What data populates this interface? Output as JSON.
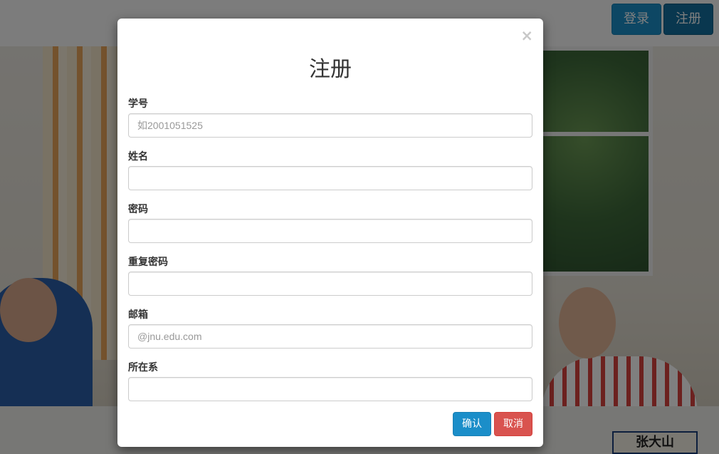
{
  "navbar": {
    "login_label": "登录",
    "register_label": "注册"
  },
  "background": {
    "nameplate_text": "张大山"
  },
  "modal": {
    "title": "注册",
    "close_symbol": "×",
    "fields": [
      {
        "label": "学号",
        "placeholder": "如2001051525",
        "value": ""
      },
      {
        "label": "姓名",
        "placeholder": "",
        "value": ""
      },
      {
        "label": "密码",
        "placeholder": "",
        "value": ""
      },
      {
        "label": "重复密码",
        "placeholder": "",
        "value": ""
      },
      {
        "label": "邮箱",
        "placeholder": "@jnu.edu.com",
        "value": ""
      },
      {
        "label": "所在系",
        "placeholder": "",
        "value": ""
      }
    ],
    "confirm_label": "确认",
    "cancel_label": "取消"
  },
  "colors": {
    "primary": "#1b8ec9",
    "danger": "#d9534f",
    "backdrop": "rgba(0,0,0,0.5)"
  }
}
